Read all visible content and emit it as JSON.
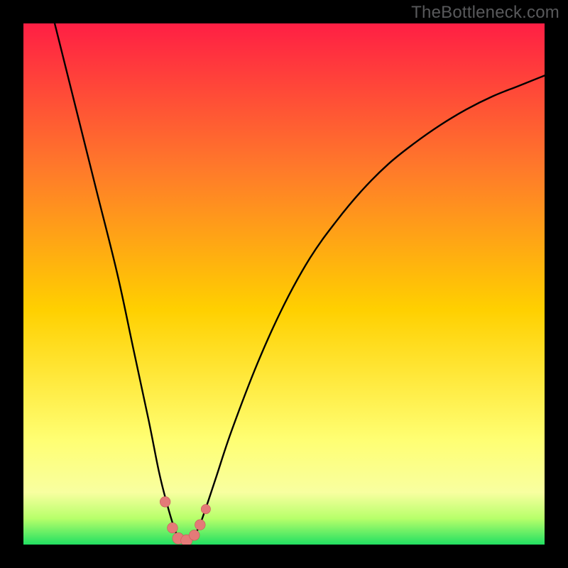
{
  "watermark": "TheBottleneck.com",
  "colors": {
    "frame": "#000000",
    "gradient_top": "#ff1f44",
    "gradient_upper": "#ff7a2a",
    "gradient_mid": "#ffd000",
    "gradient_lower": "#ffff73",
    "gradient_band_light": "#f8ffa0",
    "gradient_green_light": "#b7ff6a",
    "gradient_green": "#22e062",
    "curve": "#000000",
    "marker_fill": "#e47a78",
    "marker_stroke": "#c65a58"
  },
  "chart_data": {
    "type": "line",
    "title": "",
    "xlabel": "",
    "ylabel": "",
    "xlim": [
      0,
      100
    ],
    "ylim": [
      0,
      100
    ],
    "series": [
      {
        "name": "bottleneck-curve",
        "x": [
          6,
          10,
          14,
          18,
          21,
          24,
          26,
          27.5,
          29,
          30,
          31,
          32,
          33.5,
          35,
          37,
          40,
          45,
          50,
          55,
          60,
          65,
          70,
          75,
          80,
          85,
          90,
          95,
          100
        ],
        "values": [
          100,
          84,
          68,
          52,
          38,
          24,
          14,
          8,
          3,
          1,
          0.5,
          1,
          3,
          7,
          13,
          22,
          35,
          46,
          55,
          62,
          68,
          73,
          77,
          80.5,
          83.5,
          86,
          88,
          90
        ]
      }
    ],
    "markers": [
      {
        "x": 27.2,
        "y": 8.2,
        "r": 1.0
      },
      {
        "x": 28.6,
        "y": 3.2,
        "r": 1.0
      },
      {
        "x": 29.7,
        "y": 1.2,
        "r": 1.1
      },
      {
        "x": 31.3,
        "y": 0.8,
        "r": 1.1
      },
      {
        "x": 32.8,
        "y": 1.8,
        "r": 1.0
      },
      {
        "x": 33.9,
        "y": 3.8,
        "r": 1.0
      },
      {
        "x": 35.0,
        "y": 6.8,
        "r": 0.9
      }
    ]
  }
}
